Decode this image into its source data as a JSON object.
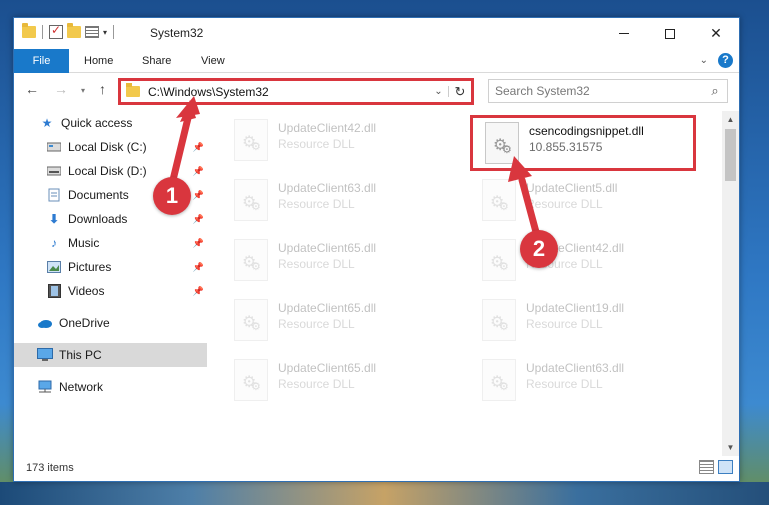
{
  "window": {
    "title": "System32",
    "controls": {
      "minimize": "—",
      "maximize": "",
      "close": "✕"
    }
  },
  "ribbon": {
    "tabs": [
      "File",
      "Home",
      "Share",
      "View"
    ],
    "expand_icon": "chevron-down-icon",
    "help": "?"
  },
  "address_bar": {
    "path": "C:\\Windows\\System32",
    "refresh": "↻"
  },
  "search": {
    "placeholder": "Search System32"
  },
  "sidebar": {
    "items": [
      {
        "label": "Quick access",
        "icon": "star-icon"
      },
      {
        "label": "Local Disk (C:)",
        "icon": "drive-icon"
      },
      {
        "label": "Local Disk (D:)",
        "icon": "drive-icon"
      },
      {
        "label": "Documents",
        "icon": "documents-icon"
      },
      {
        "label": "Downloads",
        "icon": "download-icon"
      },
      {
        "label": "Music",
        "icon": "music-icon"
      },
      {
        "label": "Pictures",
        "icon": "pictures-icon"
      },
      {
        "label": "Videos",
        "icon": "videos-icon"
      },
      {
        "label": "OneDrive",
        "icon": "cloud-icon"
      },
      {
        "label": "This PC",
        "icon": "computer-icon"
      },
      {
        "label": "Network",
        "icon": "network-icon"
      }
    ],
    "selected": "This PC"
  },
  "files": [
    {
      "name": "UpdateClient42.dll",
      "type": "Resource DLL"
    },
    {
      "name": "csencodingsnippet.dll",
      "type": "10.855.31575",
      "highlighted": true
    },
    {
      "name": "UpdateClient63.dll",
      "type": "Resource DLL"
    },
    {
      "name": "UpdateClient5.dll",
      "type": "Resource DLL"
    },
    {
      "name": "UpdateClient65.dll",
      "type": "Resource DLL"
    },
    {
      "name": "UpdateClient42.dll",
      "type": "Resource DLL"
    },
    {
      "name": "UpdateClient65.dll",
      "type": "Resource DLL"
    },
    {
      "name": "UpdateClient19.dll",
      "type": "Resource DLL"
    },
    {
      "name": "UpdateClient65.dll",
      "type": "Resource DLL"
    },
    {
      "name": "UpdateClient63.dll",
      "type": "Resource DLL"
    }
  ],
  "status": {
    "item_count": "173 items"
  },
  "annotations": {
    "step1": "1",
    "step2": "2",
    "color": "#d9363e"
  }
}
